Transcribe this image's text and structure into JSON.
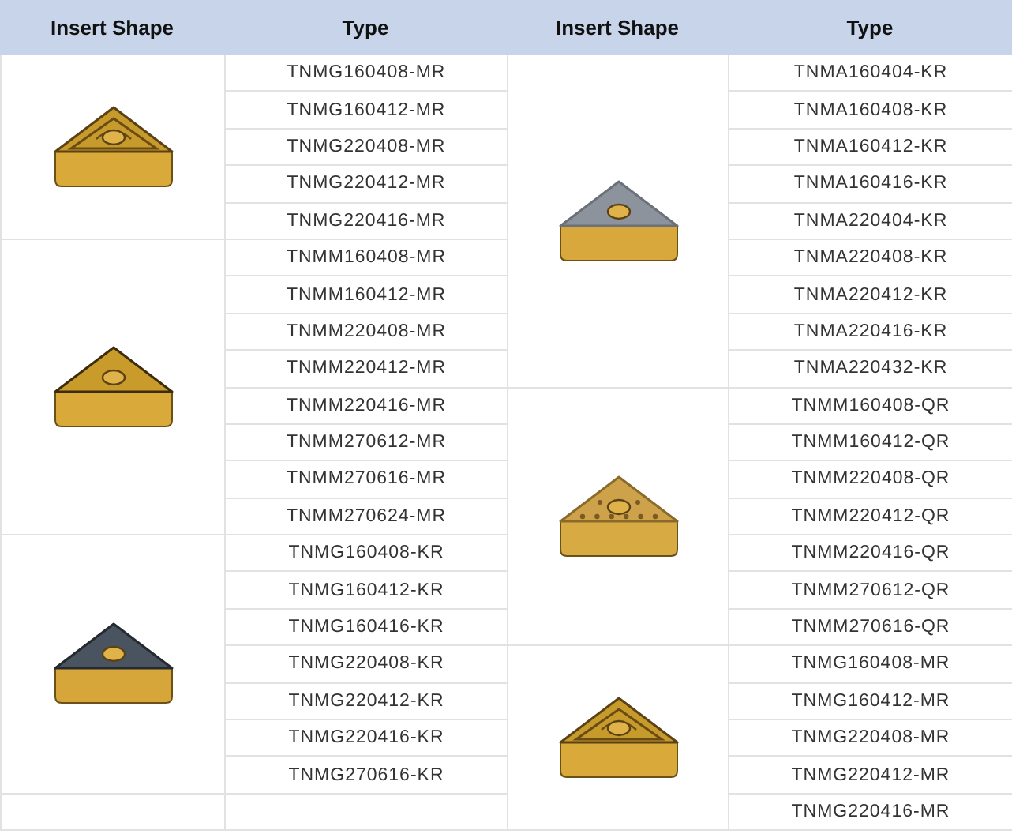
{
  "table": {
    "columns": [
      "Insert Shape",
      "Type",
      "Insert Shape",
      "Type"
    ],
    "left_groups": [
      {
        "kind": "gold-pattern",
        "types": [
          "TNMG160408-MR",
          "TNMG160412-MR",
          "TNMG220408-MR",
          "TNMG220412-MR",
          "TNMG220416-MR"
        ]
      },
      {
        "kind": "gold-plain",
        "types": [
          "TNMM160408-MR",
          "TNMM160412-MR",
          "TNMM220408-MR",
          "TNMM220412-MR",
          "TNMM220416-MR",
          "TNMM270612-MR",
          "TNMM270616-MR",
          "TNMM270624-MR"
        ]
      },
      {
        "kind": "dark-top",
        "types": [
          "TNMG160408-KR",
          "TNMG160412-KR",
          "TNMG160416-KR",
          "TNMG220408-KR",
          "TNMG220412-KR",
          "TNMG220416-KR",
          "TNMG270616-KR"
        ]
      }
    ],
    "right_groups": [
      {
        "kind": "grey-top",
        "types": [
          "TNMA160404-KR",
          "TNMA160408-KR",
          "TNMA160412-KR",
          "TNMA160416-KR",
          "TNMA220404-KR",
          "TNMA220408-KR",
          "TNMA220412-KR",
          "TNMA220416-KR",
          "TNMA220432-KR"
        ]
      },
      {
        "kind": "gold-dotted",
        "types": [
          "TNMM160408-QR",
          "TNMM160412-QR",
          "TNMM220408-QR",
          "TNMM220412-QR",
          "TNMM220416-QR",
          "TNMM270612-QR",
          "TNMM270616-QR"
        ]
      },
      {
        "kind": "gold-pattern",
        "types": [
          "TNMG160408-MR",
          "TNMG160412-MR",
          "TNMG220408-MR",
          "TNMG220412-MR",
          "TNMG220416-MR"
        ]
      }
    ]
  }
}
